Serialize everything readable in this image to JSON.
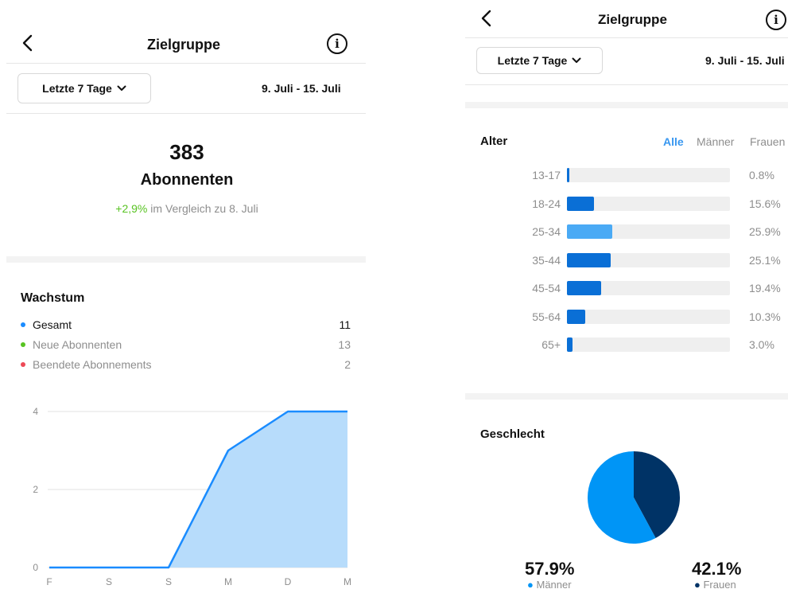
{
  "colors": {
    "accent": "#3897f0",
    "positive": "#58c322",
    "gesamt": "#1a8cff",
    "neue": "#58c322",
    "beendete": "#ed4956",
    "age_fill": "#0a6fd6",
    "age_fill_highlight": "#4aaaf5",
    "men": "#0095f6",
    "women": "#003366",
    "area_fill": "#b7dcfb",
    "area_line": "#1a8cff"
  },
  "left": {
    "header": {
      "title": "Zielgruppe",
      "back_icon": "chevron-left-icon",
      "info_icon": "info-circle-icon"
    },
    "period": {
      "label": "Letzte 7 Tage",
      "range": "9. Juli - 15. Juli"
    },
    "summary": {
      "count": "383",
      "label": "Abonnenten",
      "change": "+2,9%",
      "change_suffix": " im Vergleich zu 8. Juli"
    },
    "growth": {
      "title": "Wachstum",
      "items": [
        {
          "label": "Gesamt",
          "value": "11"
        },
        {
          "label": "Neue Abonnenten",
          "value": "13"
        },
        {
          "label": "Beendete Abonnements",
          "value": "2"
        }
      ]
    }
  },
  "chart_data": {
    "type": "area",
    "categories": [
      "F",
      "S",
      "S",
      "M",
      "D",
      "M"
    ],
    "values": [
      0,
      0,
      0,
      3,
      4,
      4
    ],
    "ylim": [
      0,
      4
    ],
    "yticks": [
      "4",
      "2",
      "0"
    ],
    "grid": true
  },
  "right": {
    "header": {
      "title": "Zielgruppe",
      "back_icon": "chevron-left-icon",
      "info_icon": "info-circle-icon"
    },
    "period": {
      "label": "Letzte 7 Tage",
      "range": "9. Juli - 15. Juli"
    },
    "age": {
      "title": "Alter",
      "filters": [
        "Alle",
        "Männer",
        "Frauen"
      ],
      "active_filter": "Alle",
      "rows": [
        {
          "label": "13-17",
          "pct": "0.8%",
          "value": 0.8
        },
        {
          "label": "18-24",
          "pct": "15.6%",
          "value": 15.6
        },
        {
          "label": "25-34",
          "pct": "25.9%",
          "value": 25.9
        },
        {
          "label": "35-44",
          "pct": "25.1%",
          "value": 25.1
        },
        {
          "label": "45-54",
          "pct": "19.4%",
          "value": 19.4
        },
        {
          "label": "55-64",
          "pct": "10.3%",
          "value": 10.3
        },
        {
          "label": "65+",
          "pct": "3.0%",
          "value": 3.0
        }
      ]
    },
    "gender": {
      "title": "Geschlecht",
      "men_pct": "57.9%",
      "men_label": "Männer",
      "men_value": 57.9,
      "women_pct": "42.1%",
      "women_label": "Frauen",
      "women_value": 42.1
    }
  }
}
